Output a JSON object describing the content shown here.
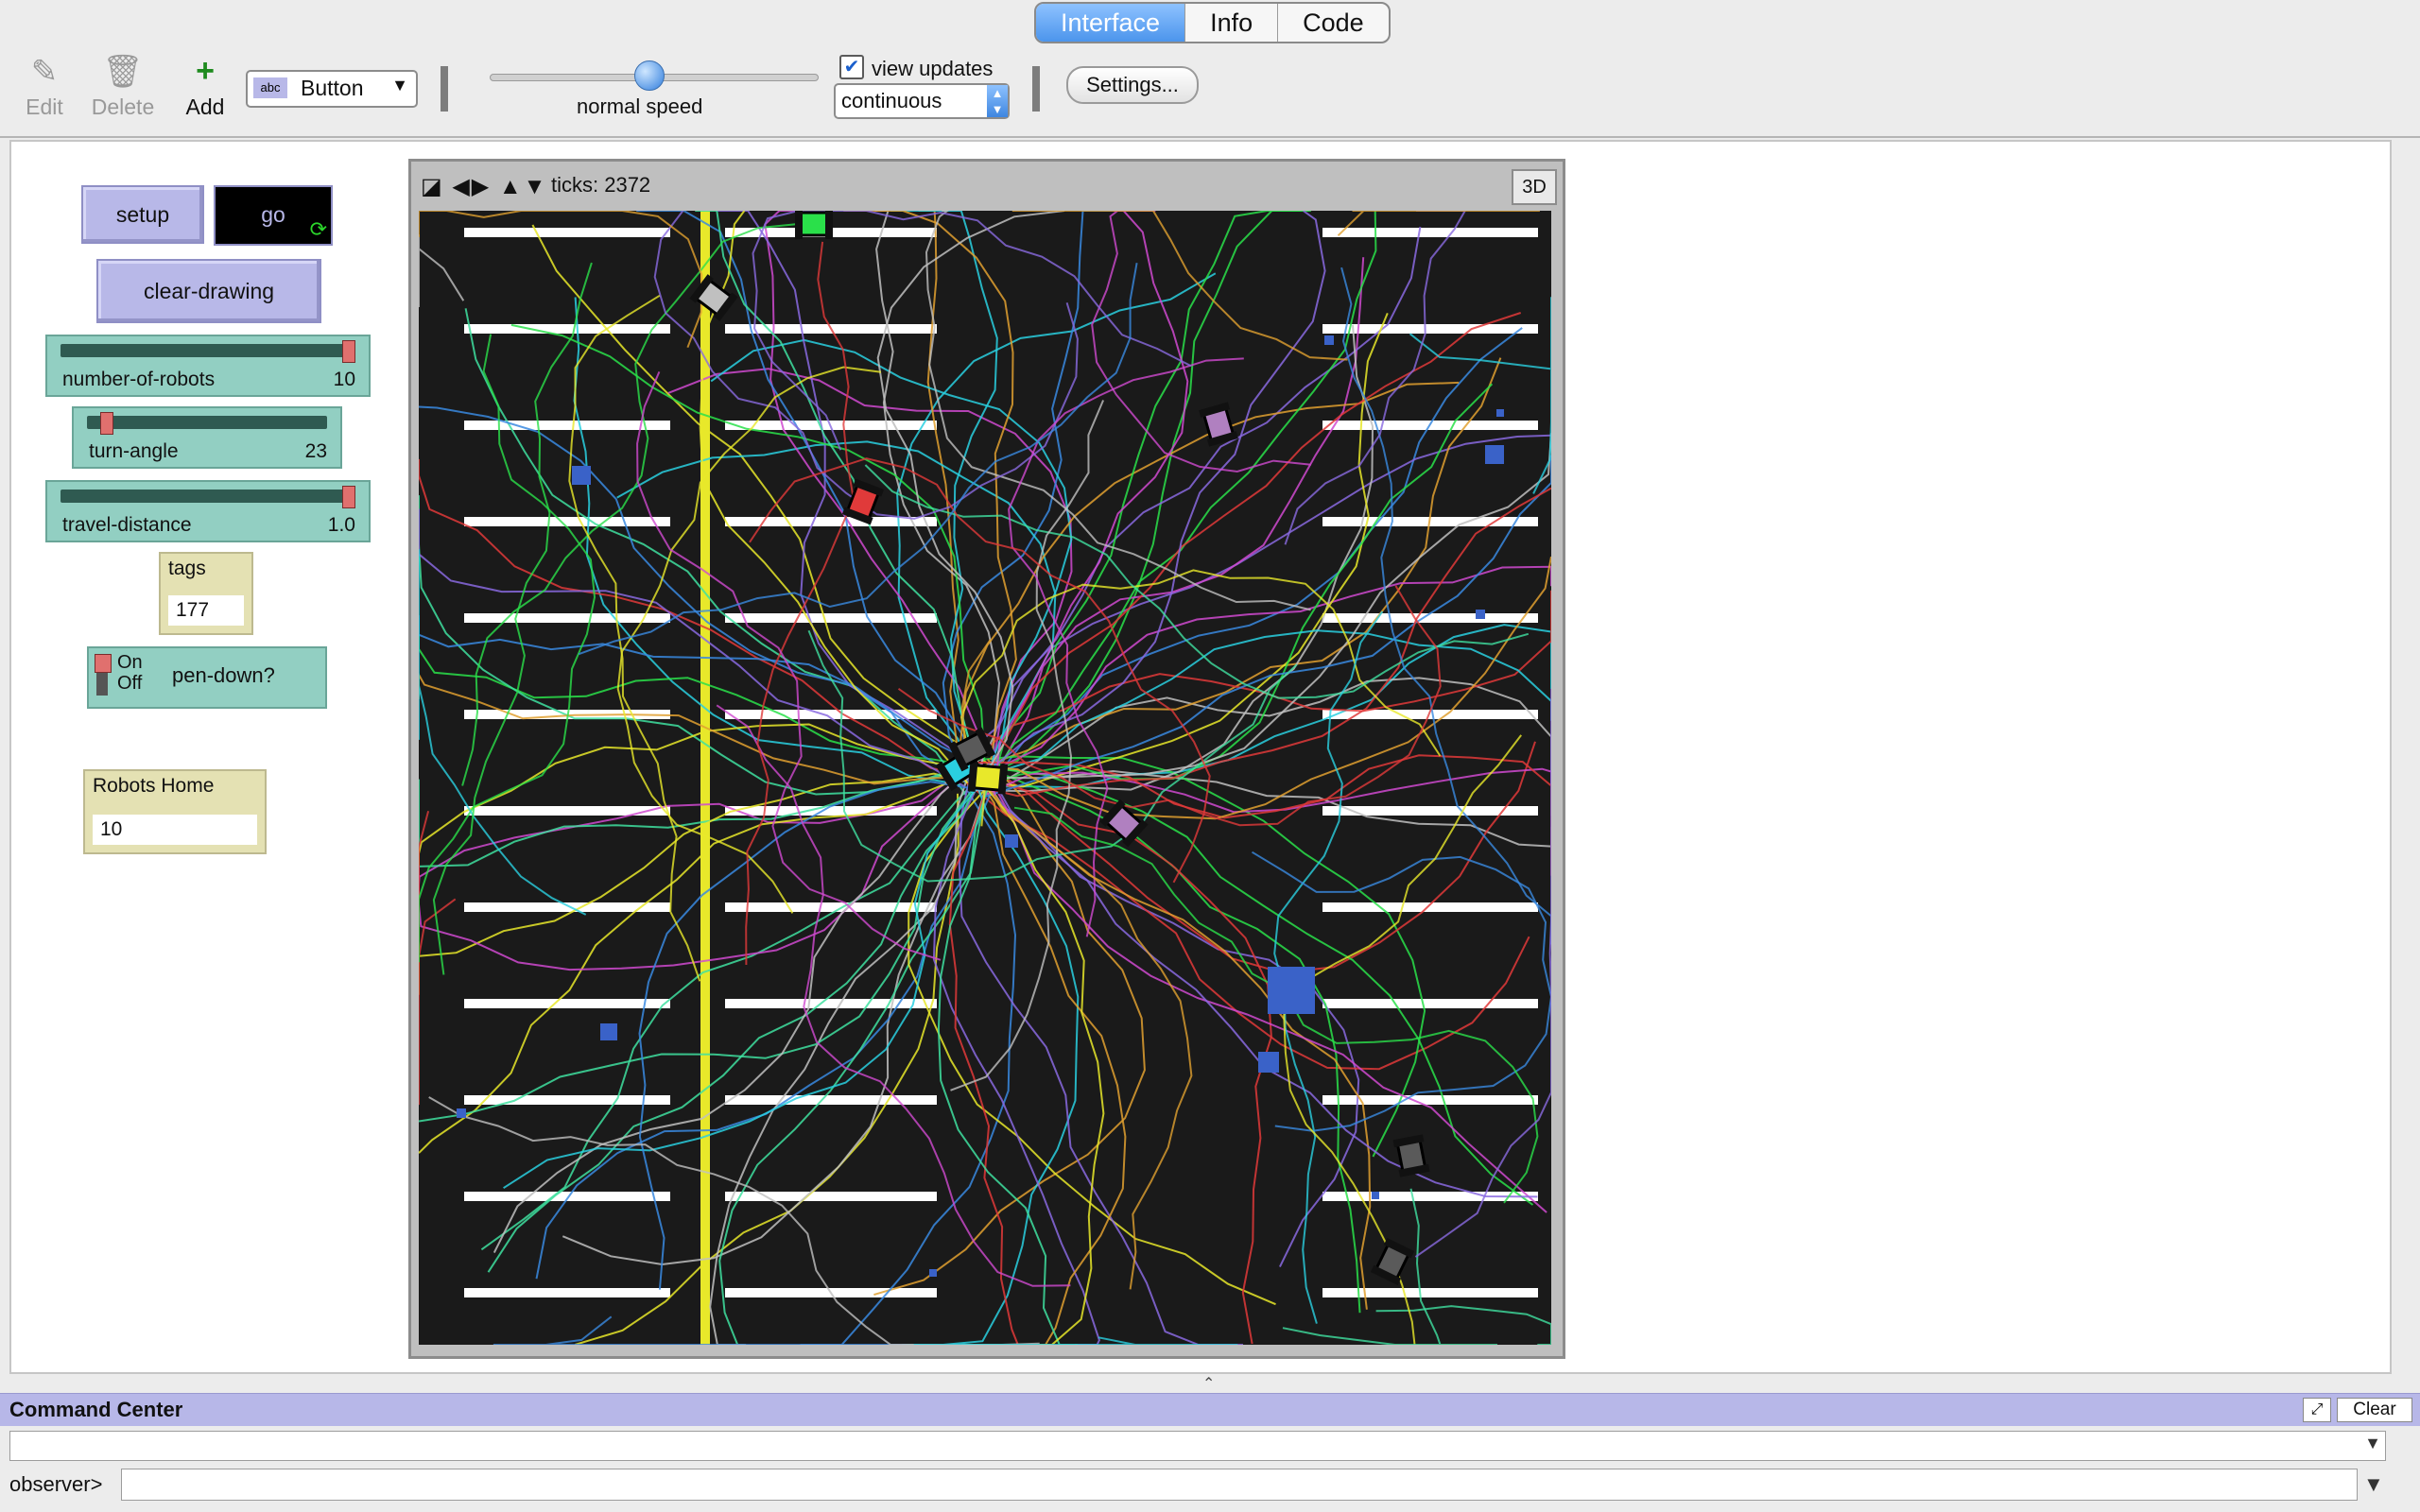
{
  "tabs": [
    "Interface",
    "Info",
    "Code"
  ],
  "toolbar": {
    "edit_label": "Edit",
    "delete_label": "Delete",
    "add_label": "Add",
    "widget_type": "Button",
    "speed_label": "normal speed",
    "view_updates_label": "view updates",
    "update_mode": "continuous",
    "settings_label": "Settings..."
  },
  "widgets": {
    "setup_label": "setup",
    "go_label": "go",
    "clear_drawing_label": "clear-drawing",
    "sliders": [
      {
        "label": "number-of-robots",
        "value": "10",
        "fraction": 1.0
      },
      {
        "label": "turn-angle",
        "value": "23",
        "fraction": 0.06
      },
      {
        "label": "travel-distance",
        "value": "1.0",
        "fraction": 1.0
      }
    ],
    "tags_label": "tags",
    "tags_value": "177",
    "switch_on": "On",
    "switch_off": "Off",
    "switch_label": "pen-down?",
    "home_label": "Robots Home",
    "home_value": "10"
  },
  "view": {
    "ticks": "ticks: 2372",
    "threed_label": "3D"
  },
  "command_center": {
    "title": "Command Center",
    "clear_label": "Clear",
    "prompt": "observer>"
  },
  "colors": {
    "accent": "#4c95ec",
    "button": "#b8b8e8",
    "slider": "#92cfc2",
    "monitor": "#e4e1b3",
    "world_bg": "#000000"
  }
}
